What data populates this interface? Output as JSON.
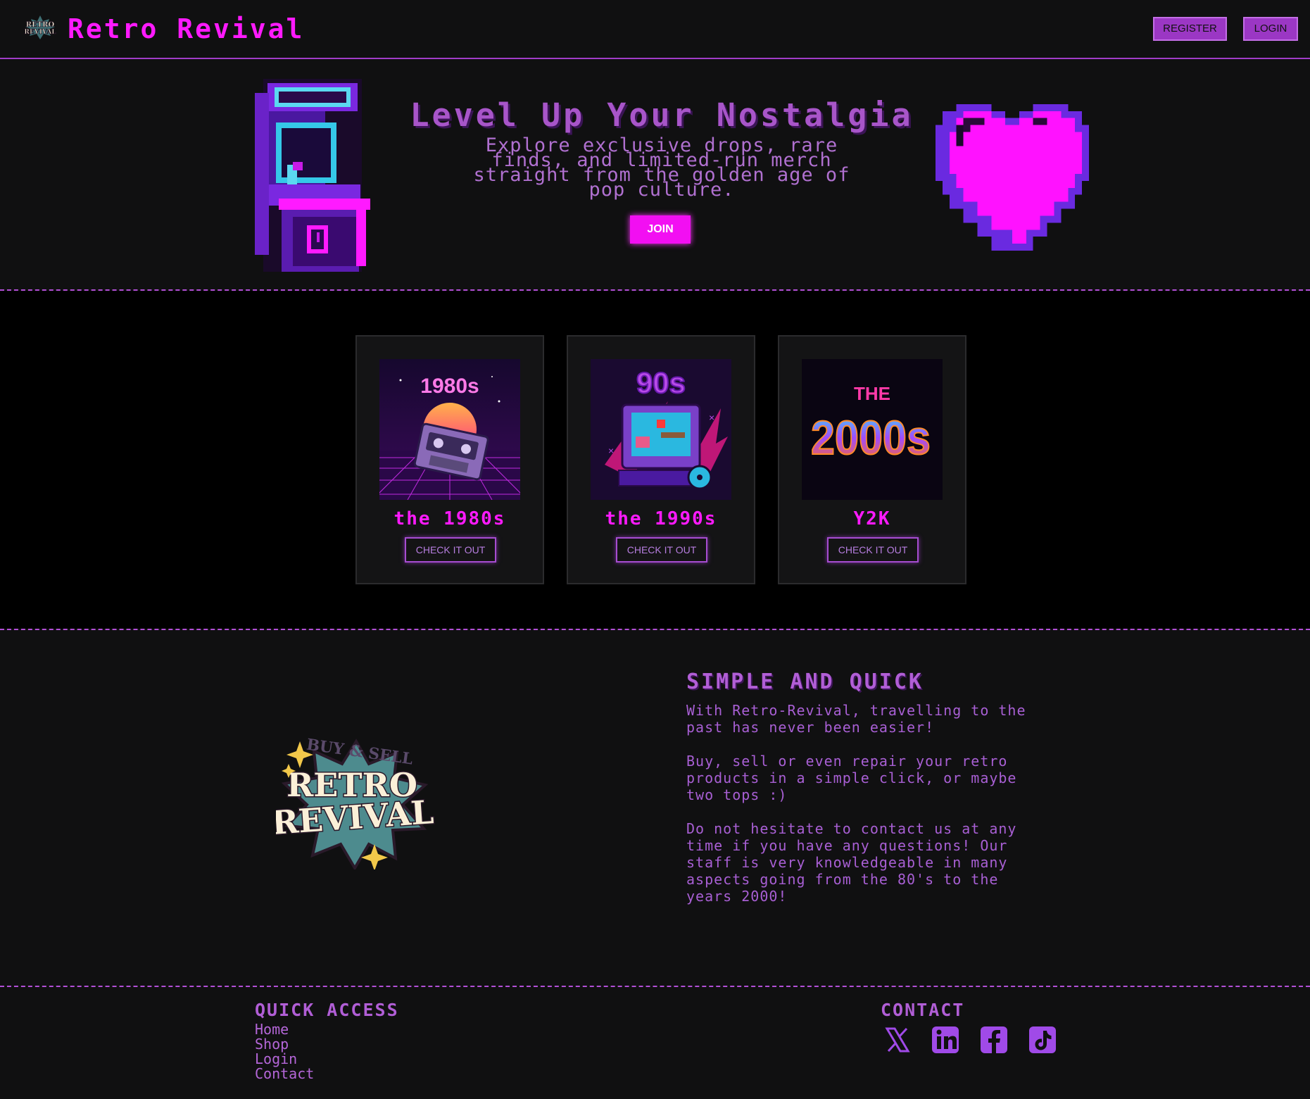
{
  "header": {
    "brand": "Retro Revival",
    "logo_icon": "retro-revival-logo",
    "register_label": "REGISTER",
    "login_label": "LOGIN"
  },
  "hero": {
    "title": "Level Up Your Nostalgia",
    "subtitle": "Explore exclusive drops, rare finds, and limited-run merch straight from the golden age of pop culture.",
    "join_label": "JOIN",
    "left_icon": "arcade-cabinet-icon",
    "right_icon": "pixel-heart-icon"
  },
  "decades": [
    {
      "title": "the 1980s",
      "button": "CHECK IT OUT",
      "image_text": "1980s"
    },
    {
      "title": "the 1990s",
      "button": "CHECK IT OUT",
      "image_text": "90s"
    },
    {
      "title": "Y2K",
      "button": "CHECK IT OUT",
      "image_text_top": "THE",
      "image_text": "2000s"
    }
  ],
  "about": {
    "title": "SIMPLE AND QUICK",
    "paragraphs": [
      "With Retro-Revival, travelling to the past has never been easier!",
      "Buy, sell or even repair your retro products in a simple click, or maybe two tops :)",
      "Do not hesitate to contact us at any time if you have any questions! Our staff is very knowledgeable in many aspects going from the 80's to the years 2000!"
    ],
    "badge_top": "BUY & SELL",
    "badge_line1": "RETRO",
    "badge_line2": "REVIVAL"
  },
  "footer": {
    "quick_access_title": "QUICK ACCESS",
    "links": [
      "Home",
      "Shop",
      "Login",
      "Contact"
    ],
    "contact_title": "CONTACT",
    "socials": [
      "x-icon",
      "linkedin-icon",
      "facebook-icon",
      "tiktok-icon"
    ]
  },
  "colors": {
    "background": "#101011",
    "neon_magenta": "#ff1aff",
    "purple": "#a855c9",
    "button_purple": "#9b37c4"
  }
}
